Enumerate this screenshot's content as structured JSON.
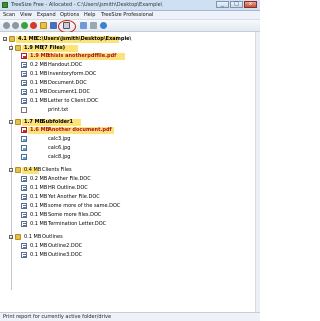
{
  "window": {
    "title": "TreeSize Free - Allocated - C:\\Users\\jsmith\\Desktop\\Example\\"
  },
  "menu": [
    "Scan",
    "View",
    "Expand",
    "Options",
    "Help",
    "TreeSize Professional"
  ],
  "root": {
    "size": "4.1 MB",
    "path": "C:\\Users\\jsmith\\Desktop\\Example\\"
  },
  "groups": [
    {
      "size": "1.9 MB",
      "name": "(7 Files)",
      "emphasis": true,
      "items": [
        {
          "size": "1.9 MB",
          "name": "thisis anotherpdffile.pdf",
          "type": "pdf",
          "emphasis": true
        },
        {
          "size": "0.2 MB",
          "name": "Handout.DOC",
          "type": "doc"
        },
        {
          "size": "0.1 MB",
          "name": "Inventoryform.DOC",
          "type": "doc"
        },
        {
          "size": "0.1 MB",
          "name": "Document.DOC",
          "type": "doc"
        },
        {
          "size": "0.1 MB",
          "name": "Document1.DOC",
          "type": "doc"
        },
        {
          "size": "0.1 MB",
          "name": "Letter to Client.DOC",
          "type": "doc"
        },
        {
          "size": "",
          "name": "print.txt",
          "type": "txt"
        }
      ]
    },
    {
      "size": "1.7 MB",
      "name": "Subfolder1",
      "emphasis": true,
      "items": [
        {
          "size": "1.6 MB",
          "name": "Another document.pdf",
          "type": "pdf",
          "emphasis": true
        },
        {
          "size": "",
          "name": "calc3.jpg",
          "type": "img"
        },
        {
          "size": "",
          "name": "calc6.jpg",
          "type": "img"
        },
        {
          "size": "",
          "name": "calc8.jpg",
          "type": "img"
        }
      ]
    },
    {
      "size": "0.4 MB",
      "name": "Clients Files",
      "emphasis": false,
      "items": [
        {
          "size": "0.2 MB",
          "name": "Another File.DOC",
          "type": "doc"
        },
        {
          "size": "0.1 MB",
          "name": "HR Outline.DOC",
          "type": "doc"
        },
        {
          "size": "0.1 MB",
          "name": "Yet Another File.DOC",
          "type": "doc"
        },
        {
          "size": "0.1 MB",
          "name": "some more of the same.DOC",
          "type": "doc"
        },
        {
          "size": "0.1 MB",
          "name": "Some more files.DOC",
          "type": "doc"
        },
        {
          "size": "0.1 MB",
          "name": "Termination Letter.DOC",
          "type": "doc"
        }
      ]
    },
    {
      "size": "0.1 MB",
      "name": "Outlines",
      "emphasis": false,
      "items": [
        {
          "size": "0.1 MB",
          "name": "Outline2.DOC",
          "type": "doc"
        },
        {
          "size": "0.1 MB",
          "name": "Outline3.DOC",
          "type": "doc"
        }
      ]
    }
  ],
  "statusbar": {
    "text": "Print report for currently active folder/drive"
  },
  "colors": {
    "highlight": "#fbe37a",
    "emphasis_text": "#b3121b",
    "circle": "#d0201a"
  },
  "toolbar_icons": [
    "back-icon",
    "forward-icon",
    "refresh-icon",
    "stop-icon",
    "folder-icon",
    "save-icon",
    "print-icon",
    "chart-icon",
    "sort-icon",
    "info-icon"
  ]
}
